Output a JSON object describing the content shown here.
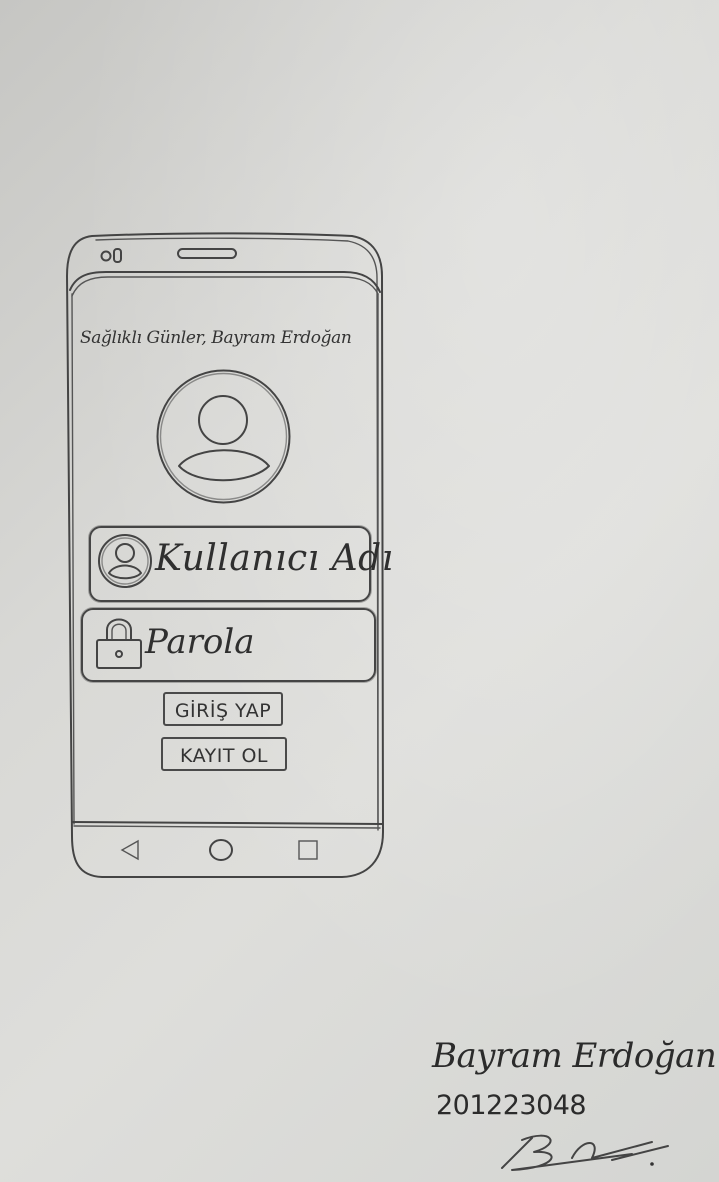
{
  "screen": {
    "greeting": "Sağlıklı Günler, Bayram Erdoğan",
    "avatar_icon": "user-avatar-icon",
    "username_field": {
      "placeholder": "Kullanıcı Adı",
      "icon": "user-circle-icon"
    },
    "password_field": {
      "placeholder": "Parola",
      "icon": "padlock-icon"
    },
    "buttons": {
      "login_label": "GİRİŞ YAP",
      "register_label": "KAYIT OL"
    },
    "nav_bar": {
      "back_icon": "triangle-back-icon",
      "home_icon": "circle-home-icon",
      "recent_icon": "square-recents-icon"
    }
  },
  "author": {
    "name": "Bayram Erdoğan",
    "student_id": "201223048",
    "signature": "Bayram Erdoğan"
  }
}
